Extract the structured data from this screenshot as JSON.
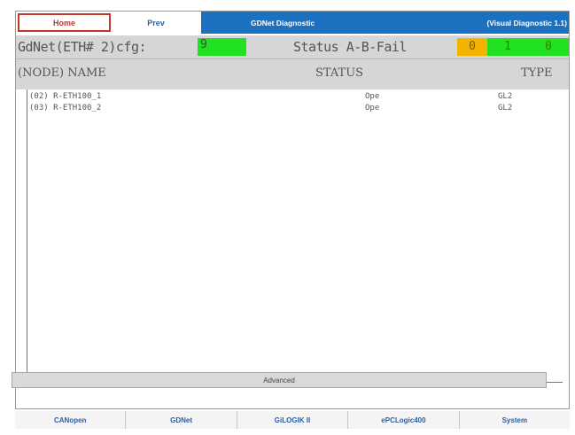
{
  "nav": {
    "home": "Home",
    "prev": "Prev",
    "title": "GDNet Diagnostic",
    "subtitle": "(Visual Diagnostic 1.1)"
  },
  "config": {
    "label": "GdNet(ETH# 2)cfg:",
    "value": "9",
    "status_label": "Status A-B-Fail",
    "counts": [
      "0",
      "1",
      "0"
    ]
  },
  "columns": {
    "node_name": "(NODE) NAME",
    "status": "STATUS",
    "type": "TYPE"
  },
  "rows": [
    {
      "name": "(02) R-ETH100_1",
      "status": "Ope",
      "type": "GL2"
    },
    {
      "name": "(03) R-ETH100_2",
      "status": "Ope",
      "type": "GL2"
    }
  ],
  "advanced_label": "Advanced",
  "bottom_tabs": [
    "CANopen",
    "GDNet",
    "GiLOGIK II",
    "ePCLogic400",
    "System"
  ],
  "colors": {
    "title_bar": "#1b71c0",
    "ok_green": "#22e022",
    "warn_amber": "#f3b400",
    "home_border": "#c0392b"
  }
}
